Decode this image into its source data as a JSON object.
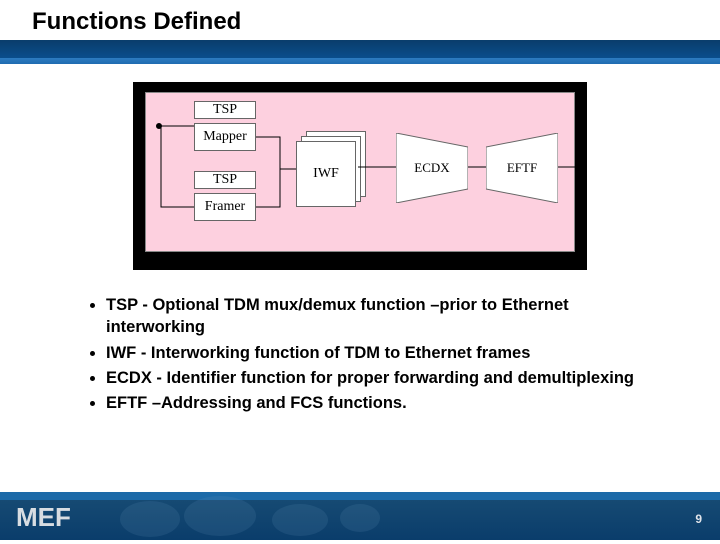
{
  "header": {
    "title": "Functions Defined"
  },
  "diagram": {
    "tsp1": "TSP",
    "mapper": "Mapper",
    "tsp2": "TSP",
    "framer": "Framer",
    "iwf": "IWF",
    "ecdx": "ECDX",
    "eftf": "EFTF"
  },
  "bullets": [
    "TSP - Optional TDM mux/demux function –prior to Ethernet interworking",
    "IWF - Interworking function of TDM to Ethernet frames",
    "ECDX - Identifier function for proper forwarding and demultiplexing",
    "EFTF –Addressing and FCS functions."
  ],
  "footer": {
    "logo": "MEF",
    "page": "9"
  }
}
